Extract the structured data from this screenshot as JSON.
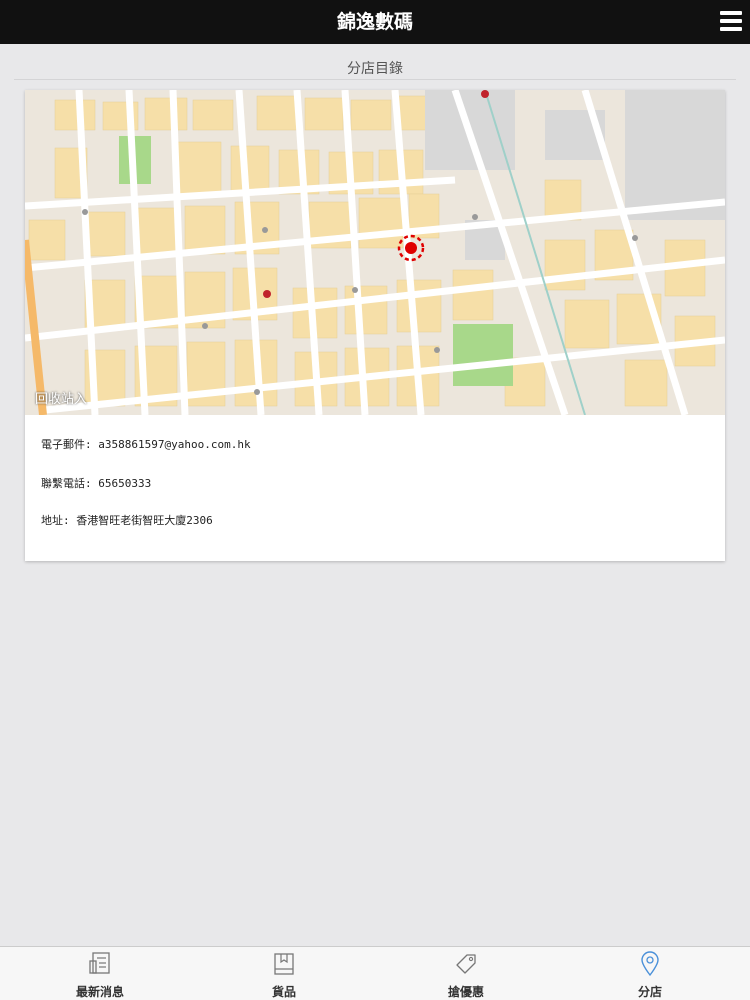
{
  "header": {
    "title": "錦逸數碼"
  },
  "page": {
    "section_title": "分店目錄"
  },
  "store": {
    "map_street_view_label": "回收站入",
    "email_label": "電子郵件:",
    "email": "a358861597@yahoo.com.hk",
    "phone_label": "聯繫電話:",
    "phone": "65650333",
    "address_label": "地址:",
    "address": "香港智旺老街智旺大廈2306"
  },
  "bottom_nav": {
    "items": [
      {
        "label": "最新消息",
        "icon": "news-icon"
      },
      {
        "label": "貨品",
        "icon": "book-icon"
      },
      {
        "label": "搶優惠",
        "icon": "tag-icon"
      },
      {
        "label": "分店",
        "icon": "location-pin-icon"
      }
    ],
    "active": "分店"
  },
  "colors": {
    "header_bg": "#111111",
    "marker": "#e00000",
    "active_nav": "#4a90d9",
    "park": "#a8d88a"
  }
}
